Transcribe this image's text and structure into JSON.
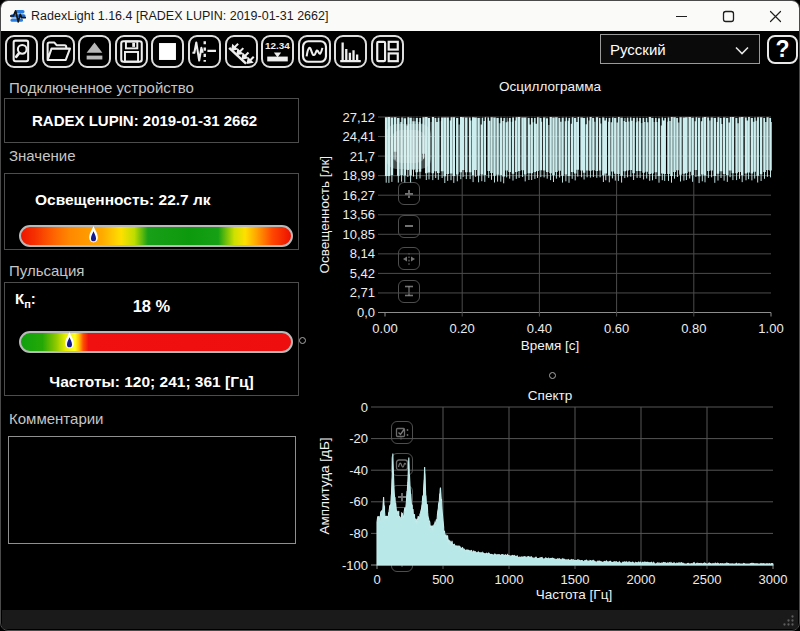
{
  "window": {
    "title": "RadexLight 1.16.4 [RADEX LUPIN: 2019-01-31 2662]",
    "controls": [
      "minimize",
      "maximize",
      "close"
    ]
  },
  "toolbar": {
    "buttons": [
      {
        "name": "find-device",
        "icon": "document-magnifier-icon"
      },
      {
        "name": "open-file",
        "icon": "open-folder-icon"
      },
      {
        "name": "eject-device",
        "icon": "eject-icon"
      },
      {
        "name": "save-file",
        "icon": "floppy-disk-icon"
      },
      {
        "name": "stop",
        "icon": "stop-square-icon"
      },
      {
        "name": "start-measure",
        "icon": "pulse-dashed-icon"
      },
      {
        "name": "light-rays-mode",
        "icon": "rays-icon"
      },
      {
        "name": "numeric-display",
        "icon": "digits-12-34-icon"
      },
      {
        "name": "oscillogram-view",
        "icon": "wave-frame-icon"
      },
      {
        "name": "spectrum-view",
        "icon": "bar-chart-icon"
      },
      {
        "name": "layout-panels",
        "icon": "split-layout-icon"
      }
    ],
    "language_select": {
      "value": "Русский"
    },
    "help_label": "?"
  },
  "left_panel": {
    "device": {
      "label": "Подключенное устройство",
      "value": "RADEX LUPIN: 2019-01-31 2662"
    },
    "value": {
      "label": "Значение",
      "reading": "Освещенность: 22.7 лк",
      "marker_pos_pct": 26.8
    },
    "pulsation": {
      "label": "Пульсация",
      "kp_letter": "К",
      "kp_sub": "п",
      "kp_colon": ":",
      "value": "18 %",
      "marker_pos_pct": 18,
      "frequencies": "Частоты: 120; 241; 361 [Гц]"
    },
    "comments": {
      "label": "Комментарии",
      "value": ""
    }
  },
  "colors": {
    "value_gradient": "linear-gradient(to right,#ee1500 0%,#f53000 5%,#ff6a00 13%,#ff8800 18%,#ffaa00 30%,#ffe000 37%,#bfdd00 42%,#18a018 47%,#0d990d 62%,#15a015 73%,#cfe000 79%,#ffe000 83%,#ffa800 87%,#ff4800 93%,#ee1000 100%)",
    "pulsation_gradient": "linear-gradient(to right,#0fa00f 0%,#25a806 8%,#8fc900 13%,#e8ee00 16.5%,#ffff20 20%,#ffc000 21.5%,#ff5000 23%,#f01010 25%,#ee0e0e 100%)",
    "trace": "#cdeeee",
    "spectrum_fill": "#b9e8e8",
    "marker_core": "#141a8c"
  },
  "chart_data": [
    {
      "type": "line",
      "title": "Осциллограмма",
      "xlabel": "Время [с]",
      "ylabel": "Освещенность [лк]",
      "x_ticks": [
        "0.00",
        "0.20",
        "0.40",
        "0.60",
        "0.80",
        "1.00"
      ],
      "y_ticks": [
        "0,0",
        "2,71",
        "5,42",
        "8,14",
        "10,85",
        "13,56",
        "16,27",
        "18,99",
        "21,7",
        "24,41",
        "27,12"
      ],
      "xlim": [
        0,
        1
      ],
      "ylim": [
        0,
        27.12
      ],
      "grid": true,
      "signal": {
        "description": "illuminance flicker waveform, dense vertical strokes",
        "fundamental_hz": 120,
        "max_lux": 27.12,
        "upper_envelope_lux": [
          25.8,
          27.12
        ],
        "lower_envelope_lux": [
          18.3,
          19.6
        ],
        "mean_lux": 22.7
      },
      "overlay_buttons": [
        "zoom-in",
        "zoom-out",
        "fit-horizontal",
        "fit-vertical"
      ]
    },
    {
      "type": "area",
      "title": "Спектр",
      "xlabel": "Частота [Гц]",
      "ylabel": "Амплитуда [дБ]",
      "x_ticks": [
        "0",
        "500",
        "1000",
        "1500",
        "2000",
        "2500",
        "3000"
      ],
      "y_ticks": [
        "0",
        "-20",
        "-40",
        "-60",
        "-80",
        "-100"
      ],
      "xlim": [
        0,
        3000
      ],
      "ylim": [
        -100,
        0
      ],
      "grid": true,
      "peaks_hz_db": [
        [
          120,
          -29.5
        ],
        [
          241,
          -32
        ],
        [
          361,
          -38
        ],
        [
          481,
          -51
        ]
      ],
      "points": [
        [
          0,
          -73
        ],
        [
          8,
          -71
        ],
        [
          15,
          -69
        ],
        [
          22,
          -70
        ],
        [
          30,
          -68
        ],
        [
          38,
          -66
        ],
        [
          44,
          -65
        ],
        [
          47,
          -61
        ],
        [
          50,
          -57
        ],
        [
          53,
          -62
        ],
        [
          57,
          -66
        ],
        [
          65,
          -69
        ],
        [
          72,
          -70
        ],
        [
          80,
          -69
        ],
        [
          88,
          -67
        ],
        [
          95,
          -64
        ],
        [
          100,
          -63
        ],
        [
          105,
          -61
        ],
        [
          110,
          -55
        ],
        [
          114,
          -46
        ],
        [
          117,
          -38
        ],
        [
          120,
          -29.5
        ],
        [
          122,
          -36
        ],
        [
          125,
          -43
        ],
        [
          128,
          -50
        ],
        [
          133,
          -57
        ],
        [
          139,
          -62
        ],
        [
          146,
          -65
        ],
        [
          155,
          -67
        ],
        [
          165,
          -69
        ],
        [
          175,
          -70
        ],
        [
          185,
          -70
        ],
        [
          195,
          -69
        ],
        [
          205,
          -67
        ],
        [
          215,
          -64
        ],
        [
          222,
          -61
        ],
        [
          228,
          -56
        ],
        [
          233,
          -49
        ],
        [
          237,
          -41
        ],
        [
          240,
          -34
        ],
        [
          241,
          -32
        ],
        [
          243,
          -37
        ],
        [
          246,
          -43
        ],
        [
          250,
          -50
        ],
        [
          255,
          -57
        ],
        [
          261,
          -62
        ],
        [
          268,
          -66
        ],
        [
          276,
          -69
        ],
        [
          285,
          -71
        ],
        [
          295,
          -71
        ],
        [
          305,
          -71
        ],
        [
          315,
          -70
        ],
        [
          325,
          -68
        ],
        [
          335,
          -65
        ],
        [
          342,
          -62
        ],
        [
          348,
          -58
        ],
        [
          353,
          -52
        ],
        [
          357,
          -46
        ],
        [
          360,
          -40
        ],
        [
          361,
          -38
        ],
        [
          363,
          -43
        ],
        [
          366,
          -49
        ],
        [
          371,
          -56
        ],
        [
          377,
          -62
        ],
        [
          384,
          -67
        ],
        [
          392,
          -71
        ],
        [
          400,
          -73
        ],
        [
          410,
          -75
        ],
        [
          420,
          -75
        ],
        [
          430,
          -75
        ],
        [
          440,
          -73
        ],
        [
          450,
          -71
        ],
        [
          458,
          -68
        ],
        [
          465,
          -64
        ],
        [
          470,
          -60
        ],
        [
          475,
          -55
        ],
        [
          479,
          -52
        ],
        [
          481,
          -51
        ],
        [
          483,
          -54
        ],
        [
          487,
          -59
        ],
        [
          492,
          -64
        ],
        [
          498,
          -70
        ],
        [
          505,
          -76
        ],
        [
          513,
          -80
        ],
        [
          525,
          -82
        ],
        [
          540,
          -84
        ],
        [
          560,
          -86
        ],
        [
          580,
          -87
        ],
        [
          600,
          -88
        ],
        [
          630,
          -89
        ],
        [
          660,
          -90
        ],
        [
          700,
          -91
        ],
        [
          750,
          -92
        ],
        [
          800,
          -92.5
        ],
        [
          900,
          -93.5
        ],
        [
          1000,
          -94
        ],
        [
          1100,
          -95
        ],
        [
          1200,
          -95.5
        ],
        [
          1300,
          -96
        ],
        [
          1400,
          -96.5
        ],
        [
          1500,
          -97
        ],
        [
          1600,
          -97.5
        ],
        [
          1700,
          -98
        ],
        [
          1800,
          -98.2
        ],
        [
          1900,
          -98.5
        ],
        [
          2000,
          -98.7
        ],
        [
          2200,
          -99
        ],
        [
          2400,
          -99.2
        ],
        [
          2600,
          -99.4
        ],
        [
          2800,
          -99.5
        ],
        [
          3000,
          -99.6
        ]
      ],
      "overlay_buttons": [
        "select-region",
        "wave-view",
        "zoom-in",
        "zoom-out",
        "fit-horizontal"
      ]
    }
  ],
  "statusbar": {}
}
